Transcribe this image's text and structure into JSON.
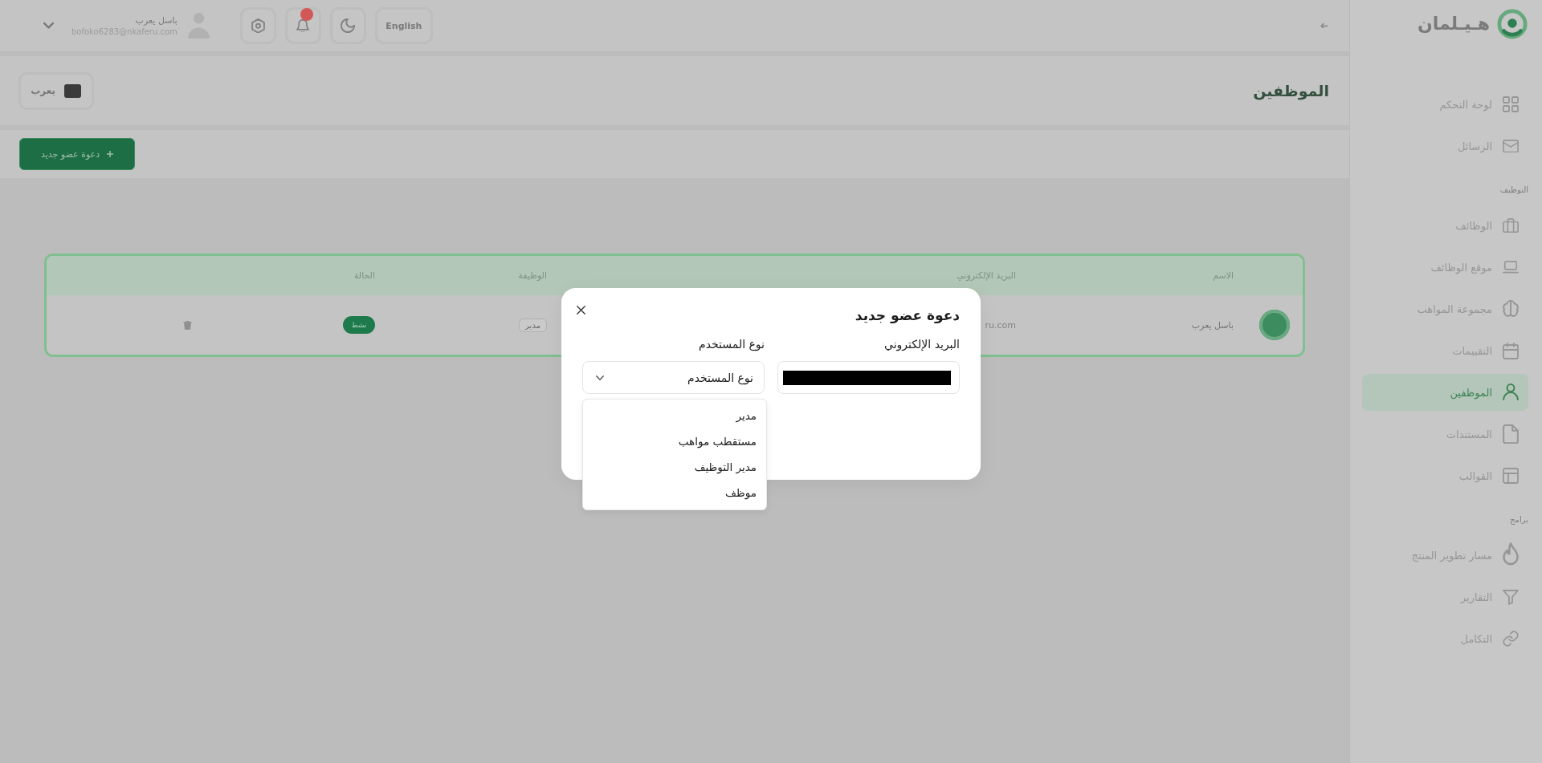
{
  "sidebar": {
    "logo_text": "هـيـلمان",
    "groups": [
      {
        "items": [
          {
            "label": "لوحة التحكم",
            "selected": false
          },
          {
            "label": "الرسائل",
            "selected": false
          }
        ]
      },
      {
        "heading": "التوظيف",
        "items": [
          {
            "label": "الوظائف",
            "selected": false
          },
          {
            "label": "موقع الوظائف",
            "selected": false
          },
          {
            "label": "مجموعة المواهب",
            "selected": false
          },
          {
            "label": "التقييمات",
            "selected": false
          },
          {
            "label": "الموظفين",
            "selected": true
          },
          {
            "label": "المستندات",
            "selected": false
          },
          {
            "label": "القوالب",
            "selected": false
          }
        ]
      },
      {
        "heading": "برامج",
        "items": [
          {
            "label": "مسار تطوير المنتج",
            "selected": false
          },
          {
            "label": "التقارير",
            "selected": false
          },
          {
            "label": "التكامل",
            "selected": false
          }
        ]
      }
    ]
  },
  "top_bar": {
    "language_button": "English",
    "notifications": {
      "unread": true
    },
    "user": {
      "name": "باسل يعرب",
      "email": "bofoko6283@nkaferu.com"
    }
  },
  "page": {
    "title": "الموظفين",
    "company_button": "يعرب",
    "invite_button": "دعوة عضو جديد"
  },
  "table": {
    "columns": [
      "الاسم",
      "البريد الإلكتروني",
      "الوظيفة",
      "الحالة"
    ],
    "rows": [
      {
        "name": "باسل يعرب",
        "email": "ru.com",
        "role": "مدير",
        "status": "نشط"
      }
    ]
  },
  "modal": {
    "title": "دعوة عضو جديد",
    "fields": [
      {
        "kind": "text",
        "label": "البريد الإلكتروني",
        "redacted": true
      },
      {
        "kind": "select",
        "label": "نوع المستخدم",
        "placeholder": "نوع المستخدم",
        "expanded": true,
        "options": [
          {
            "label": "مدير",
            "selected": false
          },
          {
            "label": "مستقطب مواهب",
            "selected": false
          },
          {
            "label": "مدير التوظيف",
            "selected": false
          },
          {
            "label": "موظف",
            "selected": false
          }
        ]
      }
    ]
  }
}
